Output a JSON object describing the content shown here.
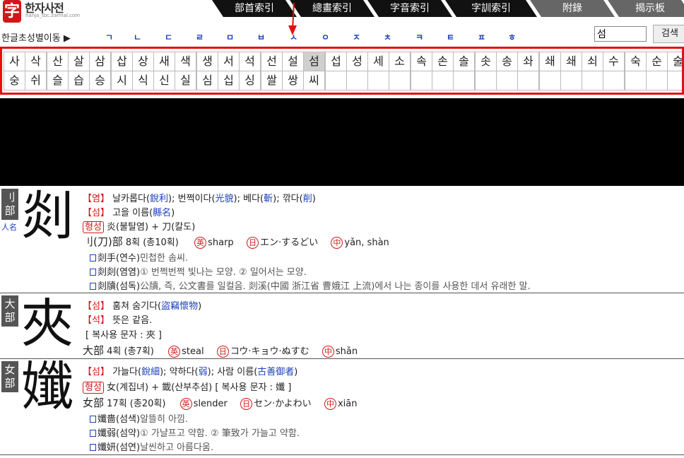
{
  "logo": {
    "mark": "字",
    "name": "한자사전",
    "url": "hanja_tbc.zarmal.com"
  },
  "tabs": [
    "部首索引",
    "總畫索引",
    "字音索引",
    "字訓索引",
    "附錄",
    "揭示板"
  ],
  "consonant_row": {
    "label": "한글초성별이동 ▶",
    "consonants": [
      "ㄱ",
      "ㄴ",
      "ㄷ",
      "ㄹ",
      "ㅁ",
      "ㅂ",
      "ㅅ",
      "ㅇ",
      "ㅈ",
      "ㅊ",
      "ㅋ",
      "ㅌ",
      "ㅍ",
      "ㅎ"
    ]
  },
  "search": {
    "value": "섬",
    "button_label": "검색"
  },
  "syllables": {
    "row1": [
      "사",
      "삭",
      "산",
      "살",
      "삼",
      "삽",
      "상",
      "새",
      "색",
      "생",
      "서",
      "석",
      "선",
      "설",
      "섬",
      "섭",
      "성",
      "세",
      "소",
      "속",
      "손",
      "솔",
      "솟",
      "송",
      "솨",
      "쇄",
      "쇄",
      "쇠",
      "수",
      "숙",
      "순",
      "술"
    ],
    "row2": [
      "숭",
      "쉬",
      "슬",
      "습",
      "승",
      "시",
      "식",
      "신",
      "실",
      "심",
      "십",
      "싱",
      "쌀",
      "쌍",
      "씨",
      "",
      "",
      "",
      "",
      "",
      "",
      "",
      "",
      "",
      "",
      "",
      "",
      "",
      "",
      "",
      "",
      ""
    ],
    "selected_index": 14
  },
  "entries": [
    {
      "radical_tag": "刂部",
      "name_tag": "人名",
      "glyph": "剡",
      "lines": {
        "l1a": "【염】",
        "l1b": " 날카롭다(",
        "l1c": "銳利",
        "l1d": "); 번쩍이다(",
        "l1e": "光貌",
        "l1f": "); 베다(",
        "l1g": "斬",
        "l1h": "); 깎다(",
        "l1i": "削",
        "l1j": ")",
        "l2a": "【섬】",
        "l2b": " 고을 이름(",
        "l2c": "縣名",
        "l2d": ")",
        "l3a": "형성",
        "l3b": " 炎(불탈염) + 刀(칼도)",
        "l4a": "刂(刀)部",
        "l4b": " 8획 (총10획)",
        "l4c": "英",
        "l4d": "sharp",
        "l4e": "日",
        "l4f": "エン·するどい",
        "l4g": "中",
        "l4h": "yǎn, shàn",
        "s1a": "剡手(연수)",
        "s1b": "민첩한 솜씨.",
        "s2a": "剡剡(염염)",
        "s2b": "① 번쩍번쩍 빛나는 모양. ② 일어서는 모양.",
        "s3a": "剡牘(섬독)",
        "s3b": "公牘, 즉, 公文書를 일컬음. 剡溪(中國 浙江省 曹娥江 上流)에서 나는 종이를 사용한 데서 유래한 말."
      }
    },
    {
      "radical_tag": "大部",
      "glyph": "夾",
      "lines": {
        "l1a": "【섬】",
        "l1b": " 훔쳐 숨기다(",
        "l1c": "盜竊懷物",
        "l1d": ")",
        "l2a": "【석】",
        "l2b": " 뜻은 같음.",
        "l3": "[ 복사용 문자 : 夾 ]",
        "l4a": "大部",
        "l4b": " 4획 (총7획)",
        "l4c": "英",
        "l4d": "steal",
        "l4e": "日",
        "l4f": "コウ·キョウ·ぬすむ",
        "l4g": "中",
        "l4h": "shǎn"
      }
    },
    {
      "radical_tag": "女部",
      "glyph": "孅",
      "lines": {
        "l1a": "【섬】",
        "l1b": " 가늘다(",
        "l1c": "銳細",
        "l1d": "); 약하다(",
        "l1e": "弱",
        "l1f": "); 사람 이름(",
        "l1g": "古善御者",
        "l1h": ")",
        "l2a": "형성",
        "l2b": " 女(계집녀) + 韱(산부추섬)   [ 복사용 문자 : 孅 ]",
        "l3a": "女部",
        "l3b": " 17획 (총20획)",
        "l3c": "英",
        "l3d": "slender",
        "l3e": "日",
        "l3f": "セン·かよわい",
        "l3g": "中",
        "l3h": "xiān",
        "s1a": "孅嗇(섬색)",
        "s1b": "알뜰히 아낌.",
        "s2a": "孅弱(섬약)",
        "s2b": "① 가냘프고 약함. ② 筆致가 가늘고 약함.",
        "s3a": "孅妍(섬연)",
        "s3b": "날씬하고 아름다움."
      }
    }
  ],
  "colors": {
    "accent_red": "#d01818",
    "link_blue": "#1a3fb8",
    "selected_cell": "#cfcfcf"
  }
}
